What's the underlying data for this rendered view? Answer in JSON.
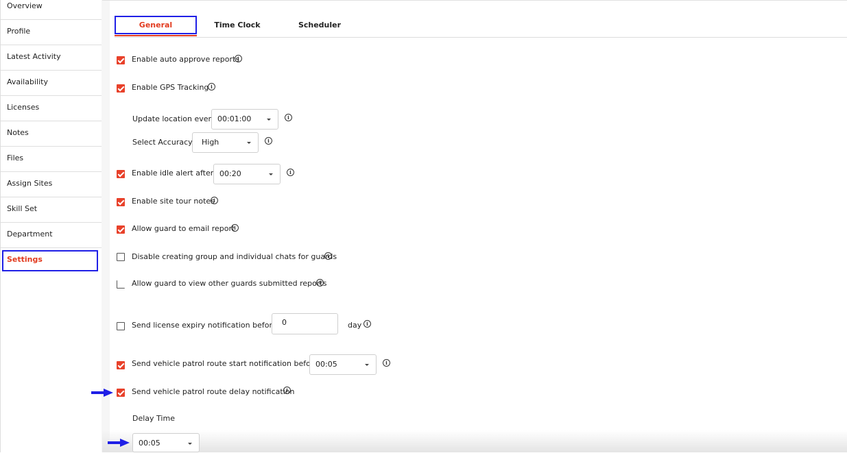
{
  "sidebar": {
    "items": [
      {
        "label": "Overview"
      },
      {
        "label": "Profile"
      },
      {
        "label": "Latest Activity"
      },
      {
        "label": "Availability"
      },
      {
        "label": "Licenses"
      },
      {
        "label": "Notes"
      },
      {
        "label": "Files"
      },
      {
        "label": "Assign Sites"
      },
      {
        "label": "Skill Set"
      },
      {
        "label": "Department"
      },
      {
        "label": "Settings"
      }
    ],
    "active": "Settings"
  },
  "tabs": [
    {
      "label": "General"
    },
    {
      "label": "Time Clock"
    },
    {
      "label": "Scheduler"
    }
  ],
  "settings": {
    "auto_approve": {
      "label": "Enable auto approve reports",
      "checked": true
    },
    "gps": {
      "label": "Enable GPS Tracking",
      "checked": true
    },
    "update_location": {
      "label": "Update location every",
      "value": "00:01:00"
    },
    "accuracy": {
      "label": "Select Accuracy",
      "value": "High"
    },
    "idle_alert": {
      "label": "Enable idle alert after",
      "value": "00:20",
      "checked": true
    },
    "site_tour": {
      "label": "Enable site tour notes",
      "checked": true
    },
    "email_report": {
      "label": "Allow guard to email report",
      "checked": true
    },
    "disable_chats": {
      "label": "Disable creating group and individual chats for guards",
      "checked": false
    },
    "view_reports": {
      "label": "Allow guard to view other guards submitted reports",
      "checked": false
    },
    "license_expiry": {
      "label": "Send license expiry notification before",
      "value": "0",
      "unit": "day",
      "checked": false
    },
    "vehicle_start": {
      "label": "Send vehicle patrol route start notification before",
      "value": "00:05",
      "checked": true
    },
    "vehicle_delay": {
      "label": "Send vehicle patrol route delay notification",
      "checked": true
    },
    "delay_time": {
      "label": "Delay Time",
      "value": "00:05"
    }
  },
  "colors": {
    "accent": "#e23b1f",
    "highlight": "#1f1fe6"
  }
}
